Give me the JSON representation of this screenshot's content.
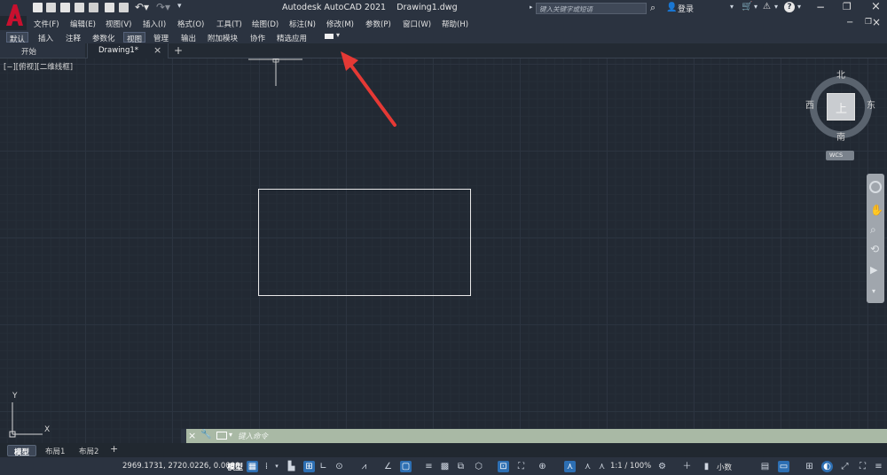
{
  "title": {
    "app": "Autodesk AutoCAD 2021",
    "file": "Drawing1.dwg",
    "search_placeholder": "键入关键字或短语",
    "login": "登录"
  },
  "menu": [
    "文件(F)",
    "编辑(E)",
    "视图(V)",
    "插入(I)",
    "格式(O)",
    "工具(T)",
    "绘图(D)",
    "标注(N)",
    "修改(M)",
    "参数(P)",
    "窗口(W)",
    "帮助(H)"
  ],
  "ribbon_tabs": [
    "默认",
    "插入",
    "注释",
    "参数化",
    "视图",
    "管理",
    "输出",
    "附加模块",
    "协作",
    "精选应用"
  ],
  "active_ribbon_tab": "视图",
  "doc_tabs": {
    "start": "开始",
    "drawing": "Drawing1*",
    "close": "×",
    "add": "+"
  },
  "viewport_label": "[−][俯视][二维线框]",
  "viewcube": {
    "north": "北",
    "south": "南",
    "east": "东",
    "west": "西",
    "top": "上",
    "wcs": "WCS"
  },
  "ucs": {
    "y": "Y",
    "x": "X"
  },
  "command": {
    "placeholder": "键入命令"
  },
  "layout_tabs": [
    "模型",
    "布局1",
    "布局2"
  ],
  "layout_add": "+",
  "status": {
    "coords": "2969.1731, 2720.0226, 0.0000",
    "model": "模型",
    "scale": "1:1 / 100%",
    "units": "小数"
  },
  "colors": {
    "accent": "#2d6fb3",
    "annotation_arrow": "#e53935",
    "logo": "#c8102e",
    "command_bar": "#a9b9a5"
  }
}
